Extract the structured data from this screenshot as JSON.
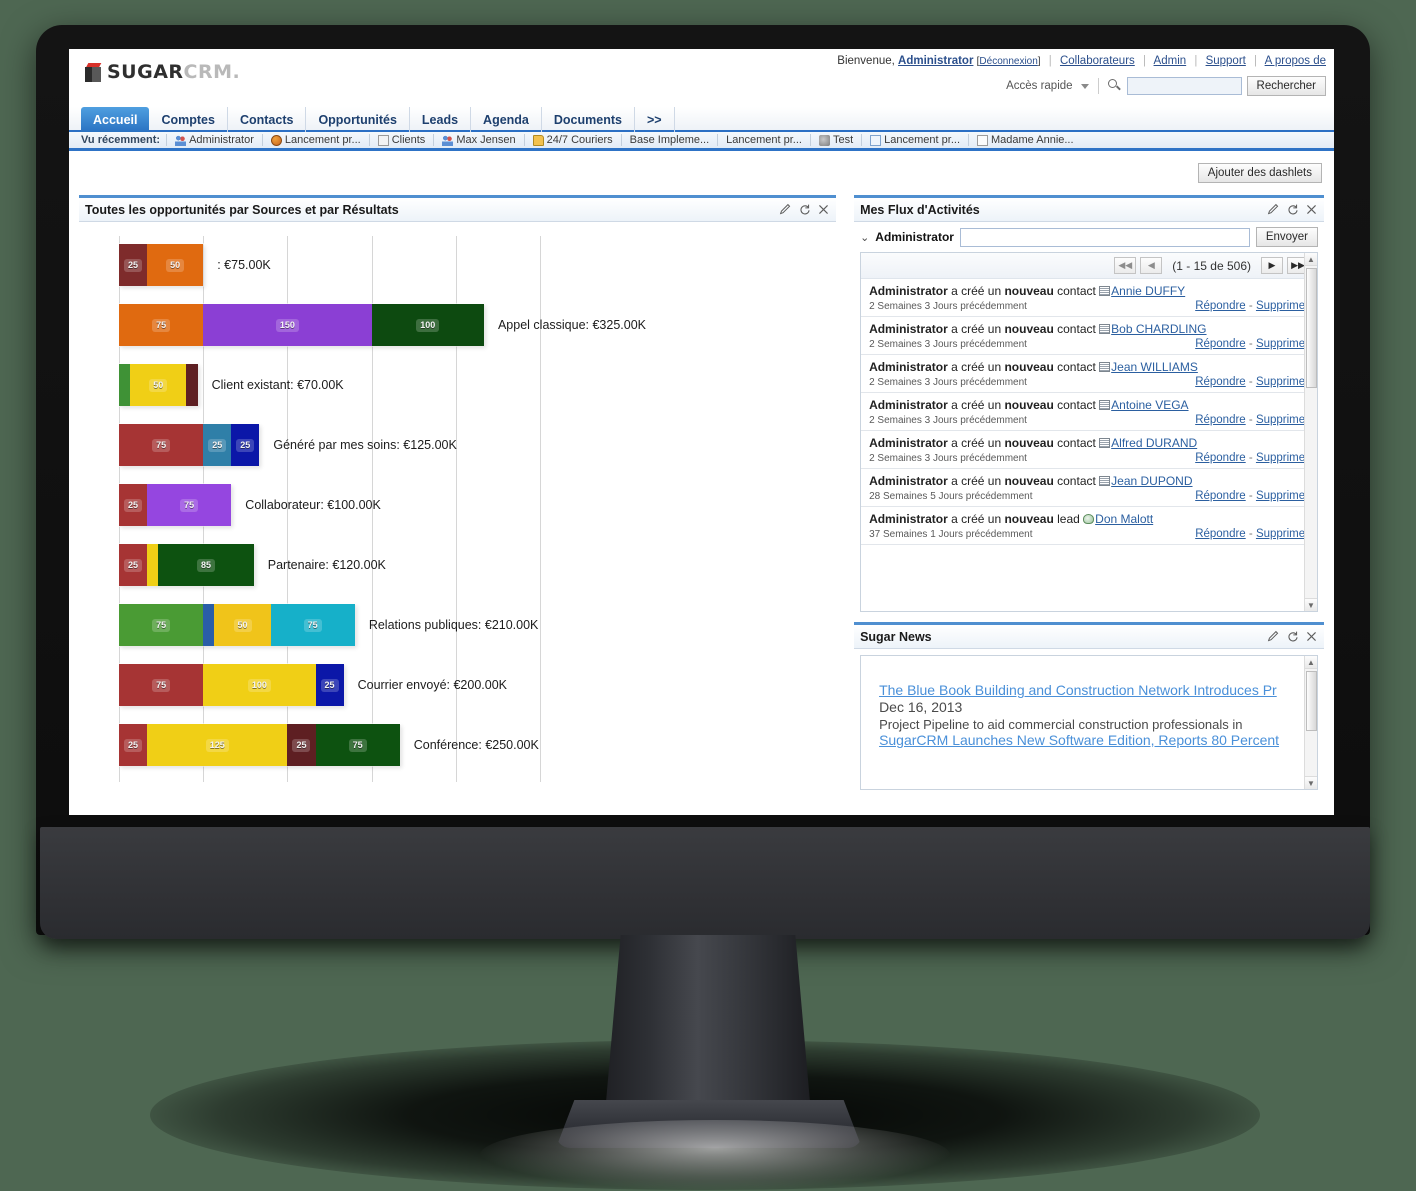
{
  "brand": {
    "word1": "SUGAR",
    "word2": "CRM."
  },
  "header": {
    "welcome_prefix": "Bienvenue,",
    "user": "Administrator",
    "logout_open": "[",
    "logout": "Déconnexion",
    "logout_close": "]",
    "links": [
      "Collaborateurs",
      "Admin",
      "Support",
      "A propos de"
    ],
    "quick_access": "Accès rapide",
    "search_value": "",
    "search_placeholder": "",
    "search_button": "Rechercher",
    "search_icon": "search-icon"
  },
  "tabs": [
    {
      "label": "Accueil",
      "active": true
    },
    {
      "label": "Comptes",
      "active": false
    },
    {
      "label": "Contacts",
      "active": false
    },
    {
      "label": "Opportunités",
      "active": false
    },
    {
      "label": "Leads",
      "active": false
    },
    {
      "label": "Agenda",
      "active": false
    },
    {
      "label": "Documents",
      "active": false
    },
    {
      "label": ">>",
      "active": false
    }
  ],
  "recent": {
    "label": "Vu récemment:",
    "items": [
      {
        "label": "Administrator",
        "icon": "person-icon"
      },
      {
        "label": "Lancement pr...",
        "icon": "globe-icon"
      },
      {
        "label": "Clients",
        "icon": "document-icon"
      },
      {
        "label": "Max Jensen",
        "icon": "person-icon"
      },
      {
        "label": "24/7 Couriers",
        "icon": "folder-icon"
      },
      {
        "label": "Base Impleme...",
        "icon": "none-icon"
      },
      {
        "label": "Lancement pr...",
        "icon": "none-icon"
      },
      {
        "label": "Test",
        "icon": "call-icon"
      },
      {
        "label": "Lancement pr...",
        "icon": "mail-icon"
      },
      {
        "label": "Madame Annie...",
        "icon": "sheet-icon"
      }
    ]
  },
  "page": {
    "add_dashlets_button": "Ajouter des dashlets"
  },
  "chart_dashlet": {
    "title": "Toutes les opportunités par Sources et par Résultats",
    "tools": [
      "edit-icon",
      "refresh-icon",
      "close-icon"
    ]
  },
  "chart_data": {
    "type": "bar",
    "orientation": "horizontal",
    "stacked": true,
    "title": "Toutes les opportunités par Sources et par Résultats",
    "xlabel": "",
    "ylabel": "",
    "xlim": [
      0,
      375
    ],
    "gridlines": [
      0,
      75,
      150,
      225,
      300,
      375
    ],
    "grid": true,
    "legend": "none",
    "value_unit": "K EUR",
    "categories": [
      {
        "label": "",
        "total_text": ": €75.00K",
        "total": 75,
        "segments": [
          {
            "value": 25,
            "color": "#7e2b2b"
          },
          {
            "value": 50,
            "color": "#e06a10"
          }
        ]
      },
      {
        "label": "Appel classique",
        "total_text": "Appel classique: €325.00K",
        "total": 325,
        "segments": [
          {
            "value": 75,
            "color": "#e06a10"
          },
          {
            "value": 150,
            "color": "#8b3fd4"
          },
          {
            "value": 100,
            "color": "#0d4a10"
          }
        ]
      },
      {
        "label": "Client existant",
        "total_text": "Client existant: €70.00K",
        "total": 70,
        "segments": [
          {
            "value": 10,
            "color": "#3f9236"
          },
          {
            "value": 50,
            "color": "#f0cf16"
          },
          {
            "value": 10,
            "color": "#5e1f22"
          }
        ]
      },
      {
        "label": "Généré par mes soins",
        "total_text": "Généré par mes soins: €125.00K",
        "total": 125,
        "segments": [
          {
            "value": 75,
            "color": "#a63434"
          },
          {
            "value": 25,
            "color": "#2f7fa8"
          },
          {
            "value": 25,
            "color": "#0b17a8"
          }
        ]
      },
      {
        "label": "Collaborateur",
        "total_text": "Collaborateur: €100.00K",
        "total": 100,
        "segments": [
          {
            "value": 25,
            "color": "#a63434"
          },
          {
            "value": 75,
            "color": "#9546e0"
          }
        ]
      },
      {
        "label": "Partenaire",
        "total_text": "Partenaire: €120.00K",
        "total": 120,
        "segments": [
          {
            "value": 25,
            "color": "#a63434"
          },
          {
            "value": 10,
            "color": "#f0cf16"
          },
          {
            "value": 85,
            "color": "#0d5210"
          }
        ]
      },
      {
        "label": "Relations publiques",
        "total_text": "Relations publiques: €210.00K",
        "total": 210,
        "segments": [
          {
            "value": 75,
            "color": "#4a9b34"
          },
          {
            "value": 10,
            "color": "#2a5ea8"
          },
          {
            "value": 50,
            "color": "#f0c41a"
          },
          {
            "value": 75,
            "color": "#16b0c9"
          }
        ]
      },
      {
        "label": "Courrier envoyé",
        "total_text": "Courrier envoyé: €200.00K",
        "total": 200,
        "segments": [
          {
            "value": 75,
            "color": "#a63434"
          },
          {
            "value": 100,
            "color": "#f0cf16"
          },
          {
            "value": 25,
            "color": "#0b17a8"
          }
        ]
      },
      {
        "label": "Conférence",
        "total_text": "Conférence: €250.00K",
        "total": 250,
        "segments": [
          {
            "value": 25,
            "color": "#a63434"
          },
          {
            "value": 125,
            "color": "#f0cf16"
          },
          {
            "value": 25,
            "color": "#5e1f22"
          },
          {
            "value": 75,
            "color": "#0d5210"
          }
        ]
      }
    ]
  },
  "feed_dashlet": {
    "title": "Mes Flux d'Activités",
    "tools": [
      "edit-icon",
      "refresh-icon",
      "close-icon"
    ],
    "compose_user": "Administrator",
    "compose_value": "",
    "send_button": "Envoyer",
    "pager_count": "(1 - 15 de 506)",
    "items": [
      {
        "actor": "Administrator",
        "verb": "a créé un",
        "adj": "nouveau",
        "object_type": "contact",
        "target": "Annie DUFFY",
        "icon": "contact-icon",
        "time": "2 Semaines 3 Jours précédemment",
        "reply": "Répondre",
        "sep": "-",
        "delete": "Supprimer"
      },
      {
        "actor": "Administrator",
        "verb": "a créé un",
        "adj": "nouveau",
        "object_type": "contact",
        "target": "Bob CHARDLING",
        "icon": "contact-icon",
        "time": "2 Semaines 3 Jours précédemment",
        "reply": "Répondre",
        "sep": "-",
        "delete": "Supprimer"
      },
      {
        "actor": "Administrator",
        "verb": "a créé un",
        "adj": "nouveau",
        "object_type": "contact",
        "target": "Jean WILLIAMS",
        "icon": "contact-icon",
        "time": "2 Semaines 3 Jours précédemment",
        "reply": "Répondre",
        "sep": "-",
        "delete": "Supprimer"
      },
      {
        "actor": "Administrator",
        "verb": "a créé un",
        "adj": "nouveau",
        "object_type": "contact",
        "target": "Antoine VEGA",
        "icon": "contact-icon",
        "time": "2 Semaines 3 Jours précédemment",
        "reply": "Répondre",
        "sep": "-",
        "delete": "Supprimer"
      },
      {
        "actor": "Administrator",
        "verb": "a créé un",
        "adj": "nouveau",
        "object_type": "contact",
        "target": "Alfred DURAND",
        "icon": "contact-icon",
        "time": "2 Semaines 3 Jours précédemment",
        "reply": "Répondre",
        "sep": "-",
        "delete": "Supprimer"
      },
      {
        "actor": "Administrator",
        "verb": "a créé un",
        "adj": "nouveau",
        "object_type": "contact",
        "target": "Jean DUPOND",
        "icon": "contact-icon",
        "time": "28 Semaines 5 Jours précédemment",
        "reply": "Répondre",
        "sep": "-",
        "delete": "Supprimer"
      },
      {
        "actor": "Administrator",
        "verb": "a créé un",
        "adj": "nouveau",
        "object_type": "lead",
        "target": "Don Malott",
        "icon": "lead-icon",
        "time": "37 Semaines 1 Jours précédemment",
        "reply": "Répondre",
        "sep": "-",
        "delete": "Supprimer"
      }
    ]
  },
  "news_dashlet": {
    "title": "Sugar News",
    "tools": [
      "edit-icon",
      "refresh-icon",
      "close-icon"
    ],
    "headline": "The Blue Book Building and Construction Network Introduces Pr",
    "date": "Dec 16, 2013",
    "description": "Project Pipeline to aid commercial construction professionals in",
    "headline2": "SugarCRM Launches New Software Edition, Reports 80 Percent"
  }
}
